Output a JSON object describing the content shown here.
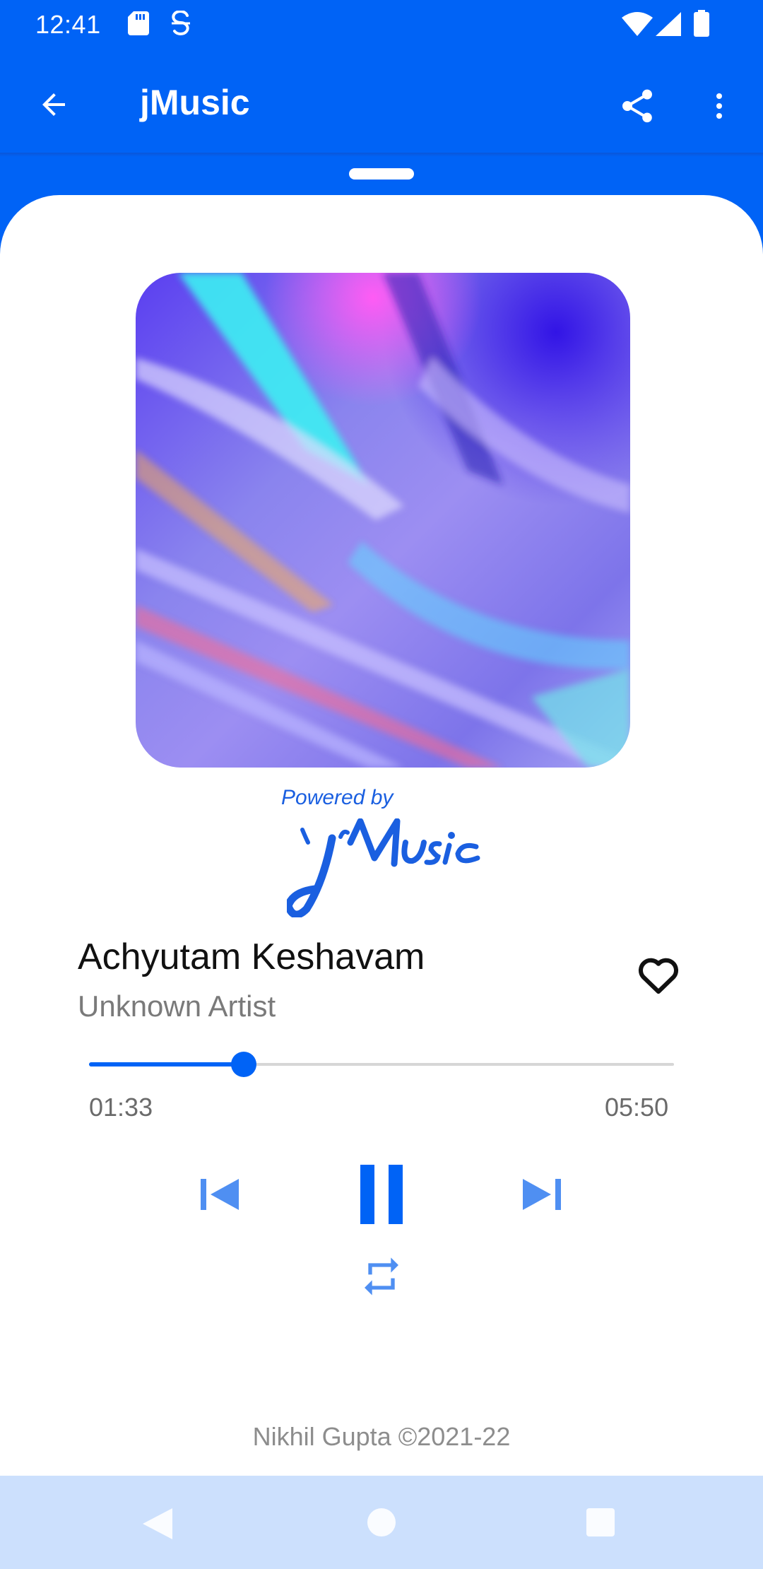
{
  "status_bar": {
    "time": "12:41",
    "icons": [
      "sd-card-icon",
      "s-icon",
      "wifi-icon",
      "signal-icon",
      "battery-icon"
    ]
  },
  "app_bar": {
    "title": "jMusic",
    "icons": [
      "back-arrow-icon",
      "share-icon",
      "more-vert-icon"
    ]
  },
  "album": {
    "powered_by": "Powered by",
    "logo_text": "jMusic"
  },
  "song": {
    "title": "Achyutam Keshavam",
    "artist": "Unknown Artist",
    "favorite_icon": "heart-outline-icon"
  },
  "player": {
    "elapsed": "01:33",
    "total": "05:50",
    "progress": 0.265,
    "icons": [
      "skip-previous-icon",
      "pause-icon",
      "skip-next-icon",
      "repeat-icon"
    ]
  },
  "footer": {
    "credit": "Nikhil Gupta ©2021-22"
  },
  "nav_bar": {
    "icons": [
      "nav-back-icon",
      "nav-home-icon",
      "nav-recents-icon"
    ]
  },
  "colors": {
    "primary": "#0063F6",
    "controls": "#4f8ff2",
    "nav_bar": "#cce0fd"
  }
}
